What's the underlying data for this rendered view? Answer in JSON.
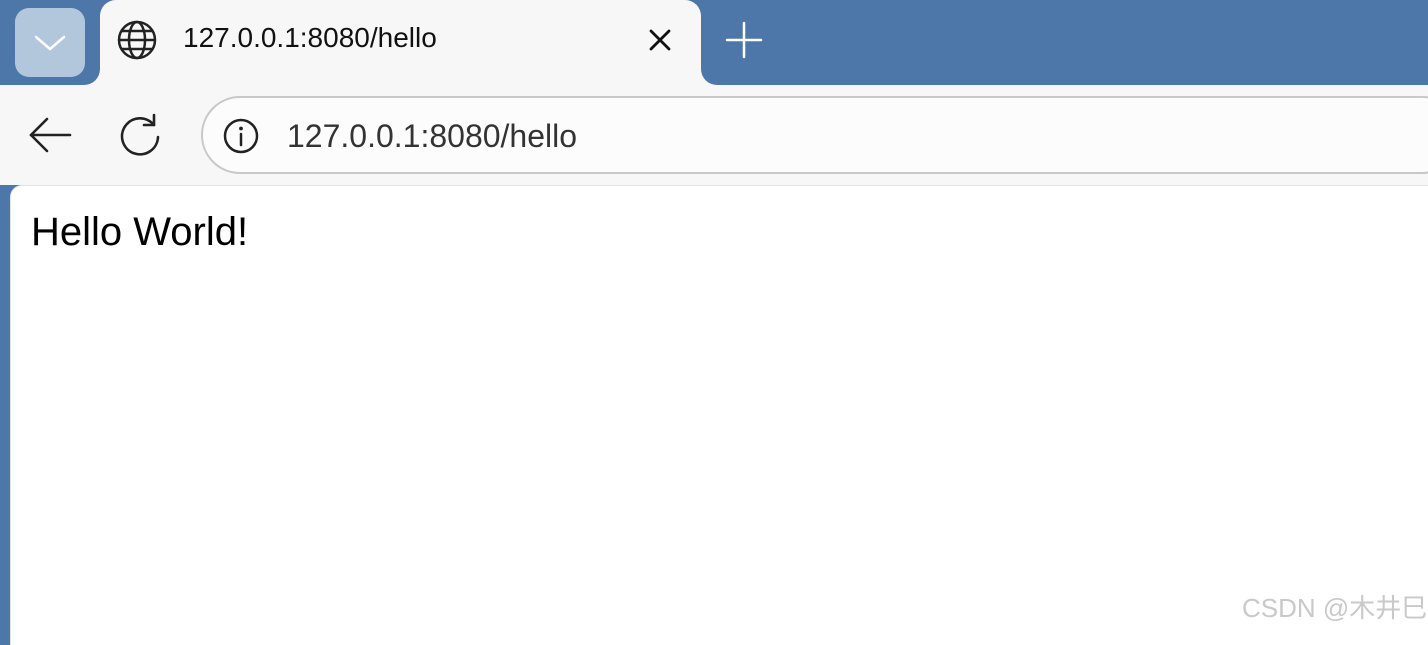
{
  "browser": {
    "accent_color": "#4d77a8",
    "tab_menu_icon": "chevron-down-icon",
    "tabs": [
      {
        "title": "127.0.0.1:8080/hello",
        "favicon": "globe-icon",
        "close_icon": "close-icon"
      }
    ],
    "new_tab_icon": "plus-icon",
    "toolbar": {
      "back_icon": "arrow-left-icon",
      "reload_icon": "reload-icon",
      "site_info_icon": "info-icon",
      "url": "127.0.0.1:8080/hello"
    }
  },
  "page": {
    "body_text": "Hello World!"
  },
  "watermark": "CSDN @木井巳"
}
